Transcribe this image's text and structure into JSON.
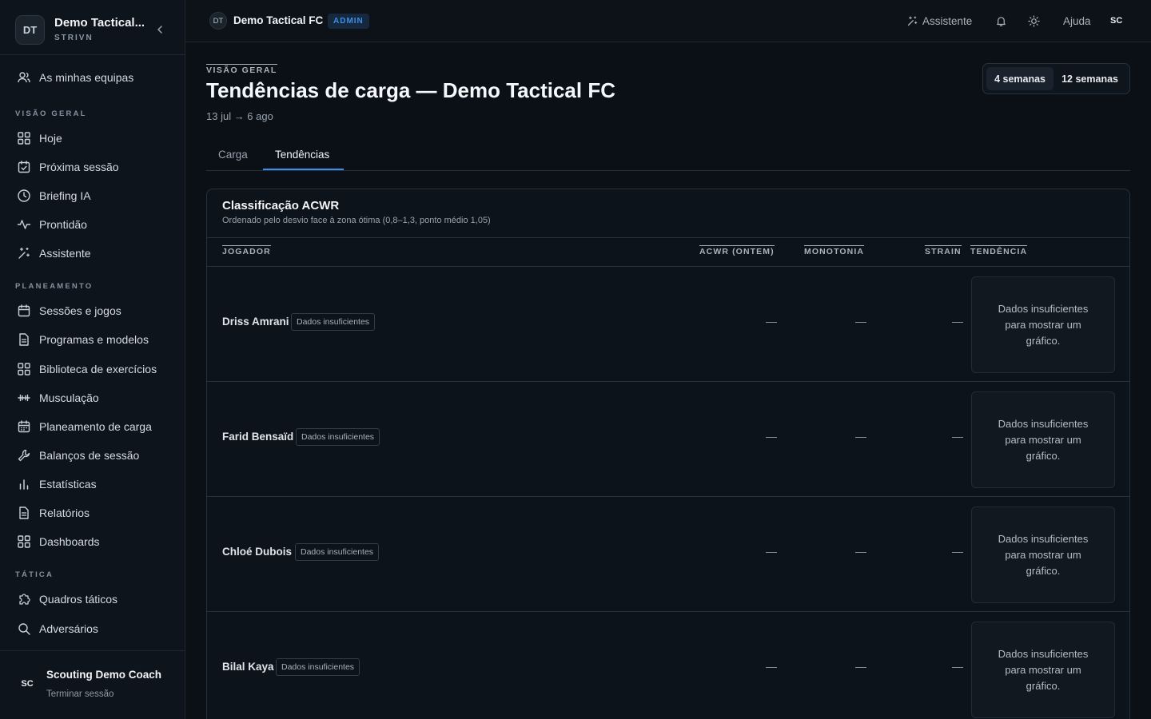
{
  "sidebar": {
    "team_initials": "DT",
    "team_name": "Demo Tactical...",
    "brand": "STRIVN",
    "my_teams": "As minhas equipas",
    "sections": {
      "overview": "VISÃO GERAL",
      "planning": "PLANEAMENTO",
      "tactics": "TÁTICA"
    },
    "items": {
      "today": "Hoje",
      "next_session": "Próxima sessão",
      "briefing": "Briefing IA",
      "readiness": "Prontidão",
      "assistant": "Assistente",
      "sessions": "Sessões e jogos",
      "programs": "Programas e modelos",
      "library": "Biblioteca de exercícios",
      "gym": "Musculação",
      "load_planning": "Planeamento de carga",
      "reviews": "Balanços de sessão",
      "stats": "Estatísticas",
      "reports": "Relatórios",
      "dashboards": "Dashboards",
      "boards": "Quadros táticos",
      "opponents": "Adversários"
    },
    "user": {
      "initials": "SC",
      "name": "Scouting Demo Coach",
      "logout": "Terminar sessão"
    }
  },
  "topbar": {
    "team_initials": "DT",
    "team_name": "Demo Tactical FC",
    "role_badge": "ADMIN",
    "assistant": "Assistente",
    "help": "Ajuda",
    "user_initials": "SC"
  },
  "page": {
    "eyebrow": "VISÃO GERAL",
    "title": "Tendências de carga — Demo Tactical FC",
    "date_range": "13 jul → 6 ago",
    "range_options": [
      "4 semanas",
      "12 semanas"
    ],
    "range_selected": "4 semanas",
    "tabs": [
      "Carga",
      "Tendências"
    ],
    "active_tab": "Tendências"
  },
  "table": {
    "title": "Classificação ACWR",
    "subtitle": "Ordenado pelo desvio face à zona ótima (0,8–1,3, ponto médio 1,05)",
    "columns": {
      "player": "JOGADOR",
      "acwr": "ACWR (ONTEM)",
      "monotony": "MONOTONIA",
      "strain": "STRAIN",
      "trend": "TENDÊNCIA"
    },
    "rows": [
      {
        "name": "Driss Amrani",
        "badge": "Dados insuficientes",
        "acwr": "—",
        "monotony": "—",
        "strain": "—",
        "trend": "Dados insuficientes para mostrar um gráfico."
      },
      {
        "name": "Farid Bensaïd",
        "badge": "Dados insuficientes",
        "acwr": "—",
        "monotony": "—",
        "strain": "—",
        "trend": "Dados insuficientes para mostrar um gráfico."
      },
      {
        "name": "Chloé Dubois",
        "badge": "Dados insuficientes",
        "acwr": "—",
        "monotony": "—",
        "strain": "—",
        "trend": "Dados insuficientes para mostrar um gráfico."
      },
      {
        "name": "Bilal Kaya",
        "badge": "Dados insuficientes",
        "acwr": "—",
        "monotony": "—",
        "strain": "—",
        "trend": "Dados insuficientes para mostrar um gráfico."
      }
    ]
  },
  "colors": {
    "background": "#0b1016",
    "accent": "#3c8ee8",
    "border": "#26313b"
  }
}
